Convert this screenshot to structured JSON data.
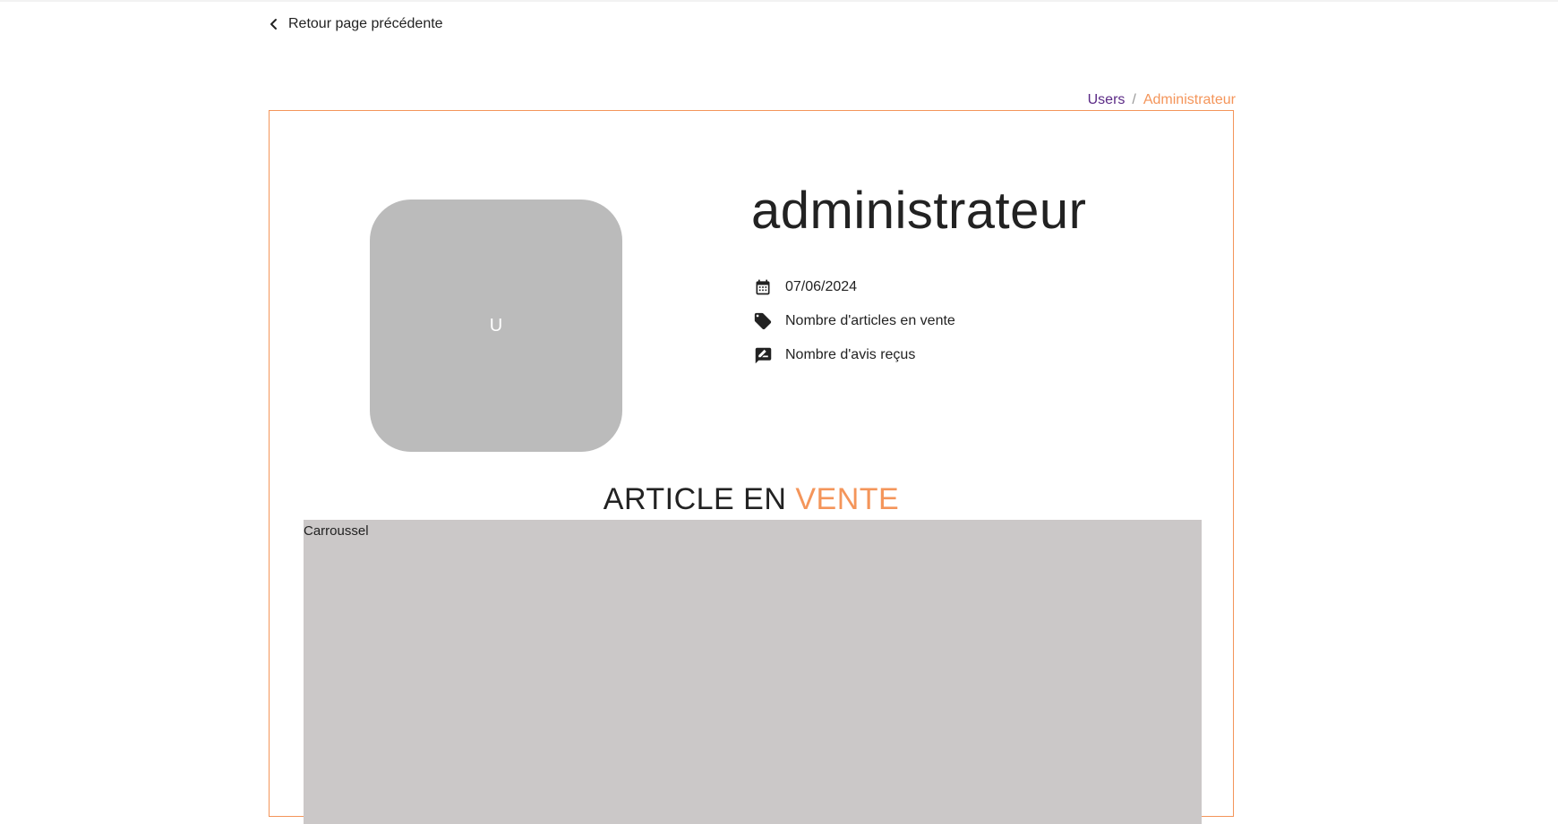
{
  "nav": {
    "back_label": "Retour page précédente"
  },
  "breadcrumb": {
    "parent": "Users",
    "separator": "/",
    "current": "Administrateur"
  },
  "profile": {
    "avatar_initial": "U",
    "name": "administrateur",
    "info": [
      {
        "icon": "calendar-icon",
        "text": "07/06/2024"
      },
      {
        "icon": "tag-icon",
        "text": "Nombre d'articles en vente"
      },
      {
        "icon": "rate-review-icon",
        "text": "Nombre d'avis reçus"
      }
    ]
  },
  "section": {
    "title_main": "ARTICLE EN ",
    "title_accent": "VENTE"
  },
  "carousel": {
    "label": "Carroussel"
  },
  "colors": {
    "accent": "#f4955a",
    "breadcrumb_link": "#5b2a86",
    "avatar_bg": "#bbbbbb",
    "carousel_bg": "#cbc8c8"
  }
}
